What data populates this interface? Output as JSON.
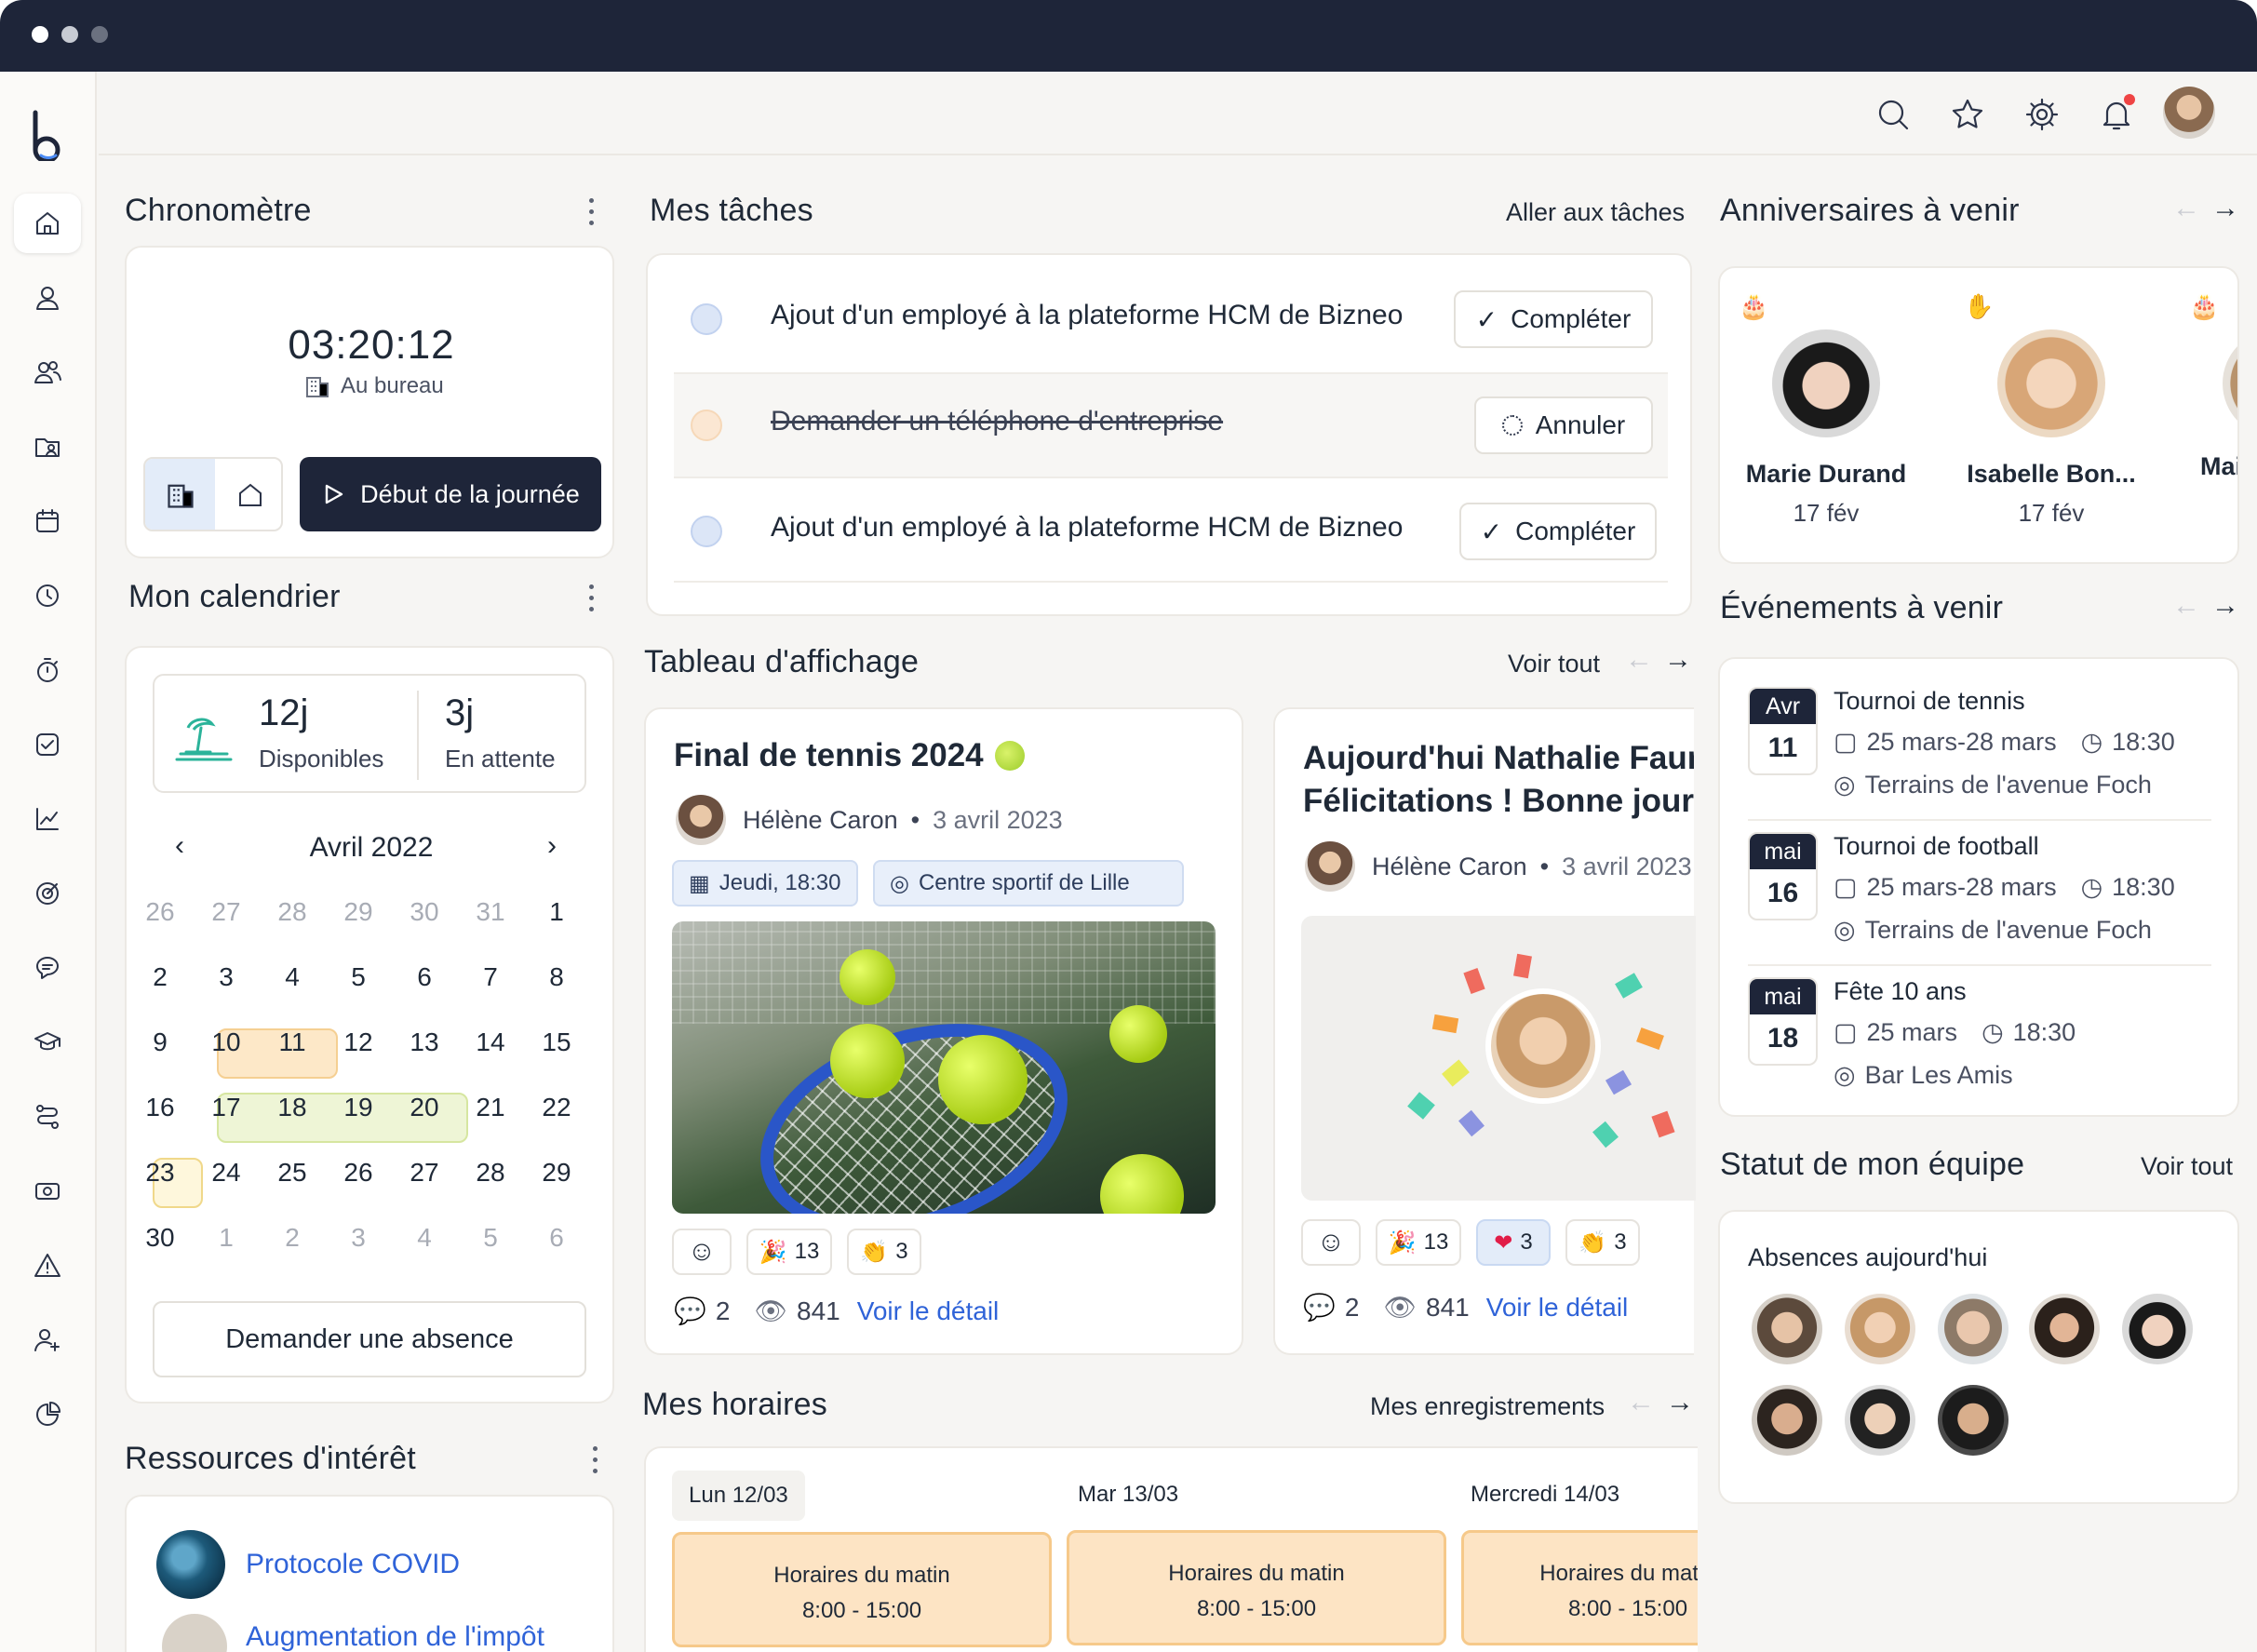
{
  "window": {
    "dots": [
      "#ffffff",
      "#c7cbd3",
      "#6b7180"
    ]
  },
  "sidebar": {
    "logo": "b",
    "items": [
      "home-icon",
      "user-icon",
      "users-icon",
      "folder-user-icon",
      "calendar-icon",
      "clock-icon",
      "stopwatch-icon",
      "checkbox-icon",
      "chart-line-icon",
      "target-icon",
      "chat-icon",
      "graduation-cap-icon",
      "route-icon",
      "money-icon",
      "alert-icon",
      "user-plus-icon",
      "pie-chart-icon"
    ]
  },
  "topbar": {
    "icons": [
      "search-icon",
      "star-icon",
      "gear-icon",
      "bell-icon",
      "avatar"
    ]
  },
  "chrono": {
    "title": "Chronomètre",
    "time": "03:20:12",
    "location": "Au bureau",
    "start_label": "Début de la journée"
  },
  "calendar": {
    "title": "Mon calendrier",
    "available_value": "12j",
    "available_label": "Disponibles",
    "pending_value": "3j",
    "pending_label": "En attente",
    "month": "Avril 2022",
    "prev": "‹",
    "next": "›",
    "weeks": [
      [
        "26",
        "27",
        "28",
        "29",
        "30",
        "31",
        "1"
      ],
      [
        "2",
        "3",
        "4",
        "5",
        "6",
        "7",
        "8"
      ],
      [
        "9",
        "10",
        "11",
        "12",
        "13",
        "14",
        "15"
      ],
      [
        "16",
        "17",
        "18",
        "19",
        "20",
        "21",
        "22"
      ],
      [
        "23",
        "24",
        "25",
        "26",
        "27",
        "28",
        "29"
      ],
      [
        "30",
        "1",
        "2",
        "3",
        "4",
        "5",
        "6"
      ]
    ],
    "request_label": "Demander une absence"
  },
  "resources": {
    "title": "Ressources d'intérêt",
    "items": [
      "Protocole COVID",
      "Augmentation de l'impôt"
    ]
  },
  "tasks": {
    "title": "Mes tâches",
    "link": "Aller aux tâches",
    "items": [
      {
        "text": "Ajout d'un employé à la plateforme HCM de Bizneo",
        "action": "Compléter",
        "done": false
      },
      {
        "text": "Demander un téléphone d'entreprise",
        "action": "Annuler",
        "done": true
      },
      {
        "text": "Ajout d'un employé à la plateforme HCM de Bizneo",
        "action": "Compléter",
        "done": false
      }
    ]
  },
  "board": {
    "title": "Tableau d'affichage",
    "link": "Voir tout",
    "posts": [
      {
        "title": "Final de tennis 2024",
        "author": "Hélène Caron",
        "date": "3 avril 2023",
        "chip_date": "Jeudi, 18:30",
        "chip_place": "Centre sportif de Lille",
        "reactions": [
          "13",
          "3"
        ],
        "comments": "2",
        "views": "841",
        "detail": "Voir le détail"
      },
      {
        "title_line1": "Aujourd'hui Nathalie Faure",
        "title_line2": "Félicitations ! Bonne journée",
        "author": "Hélène Caron",
        "date": "3 avril 2023",
        "reactions": [
          "13",
          "3",
          "3"
        ],
        "comments": "2",
        "views": "841",
        "detail": "Voir le détail"
      }
    ]
  },
  "schedule": {
    "title": "Mes horaires",
    "link": "Mes enregistrements",
    "days": [
      {
        "label": "Lun 12/03",
        "shift": "Horaires du matin",
        "hours": "8:00 - 15:00"
      },
      {
        "label": "Mar 13/03",
        "shift": "Horaires du matin",
        "hours": "8:00 - 15:00"
      },
      {
        "label": "Mercredi 14/03",
        "shift": "Horaires du matin",
        "hours": "8:00 - 15:00"
      }
    ]
  },
  "birthdays": {
    "title": "Anniversaires à venir",
    "people": [
      {
        "name": "Marie Durand",
        "date": "17 fév"
      },
      {
        "name": "Isabelle Bon...",
        "date": "17 fév"
      },
      {
        "name": "Mai",
        "date": ""
      }
    ]
  },
  "events": {
    "title": "Événements à venir",
    "items": [
      {
        "month": "Avr",
        "day": "11",
        "name": "Tournoi de tennis",
        "dates": "25 mars-28 mars",
        "time": "18:30",
        "place": "Terrains de l'avenue Foch"
      },
      {
        "month": "mai",
        "day": "16",
        "name": "Tournoi de football",
        "dates": "25 mars-28 mars",
        "time": "18:30",
        "place": "Terrains de l'avenue Foch"
      },
      {
        "month": "mai",
        "day": "18",
        "name": "Fête 10 ans",
        "dates": "25 mars",
        "time": "18:30",
        "place": "Bar Les Amis"
      }
    ]
  },
  "team": {
    "title": "Statut de mon équipe",
    "link": "Voir tout",
    "subtitle": "Absences aujourd'hui"
  }
}
